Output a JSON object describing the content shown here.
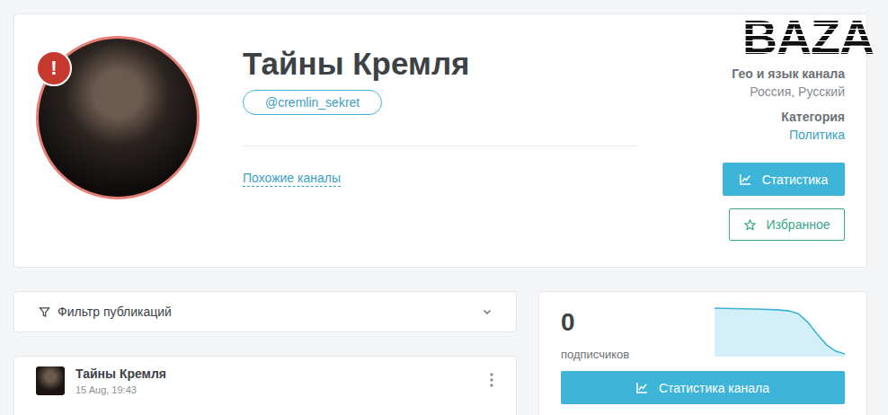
{
  "logo": "BAZA",
  "channel": {
    "title": "Тайны Кремля",
    "handle": "@cremlin_sekret",
    "warning": "!",
    "similar_link": "Похожие каналы"
  },
  "info": [
    {
      "label": "Гео и язык канала",
      "value": "Россия, Русский",
      "link": false
    },
    {
      "label": "Категория",
      "value": "Политика",
      "link": true
    }
  ],
  "buttons": {
    "stats": "Статистика",
    "favorite": "Избранное"
  },
  "filter": {
    "label": "Фильтр публикаций",
    "expanded": false
  },
  "posts": [
    {
      "channel": "Тайны Кремля",
      "time": "15 Aug, 19:43"
    }
  ],
  "subscribers": {
    "count": "0",
    "label": "подписчиков",
    "chart": {
      "values": [
        100,
        99.5,
        99,
        98.5,
        98,
        97.5,
        97,
        96,
        94,
        88,
        70,
        45,
        22,
        8,
        2
      ]
    },
    "button": "Статистика канала"
  }
}
